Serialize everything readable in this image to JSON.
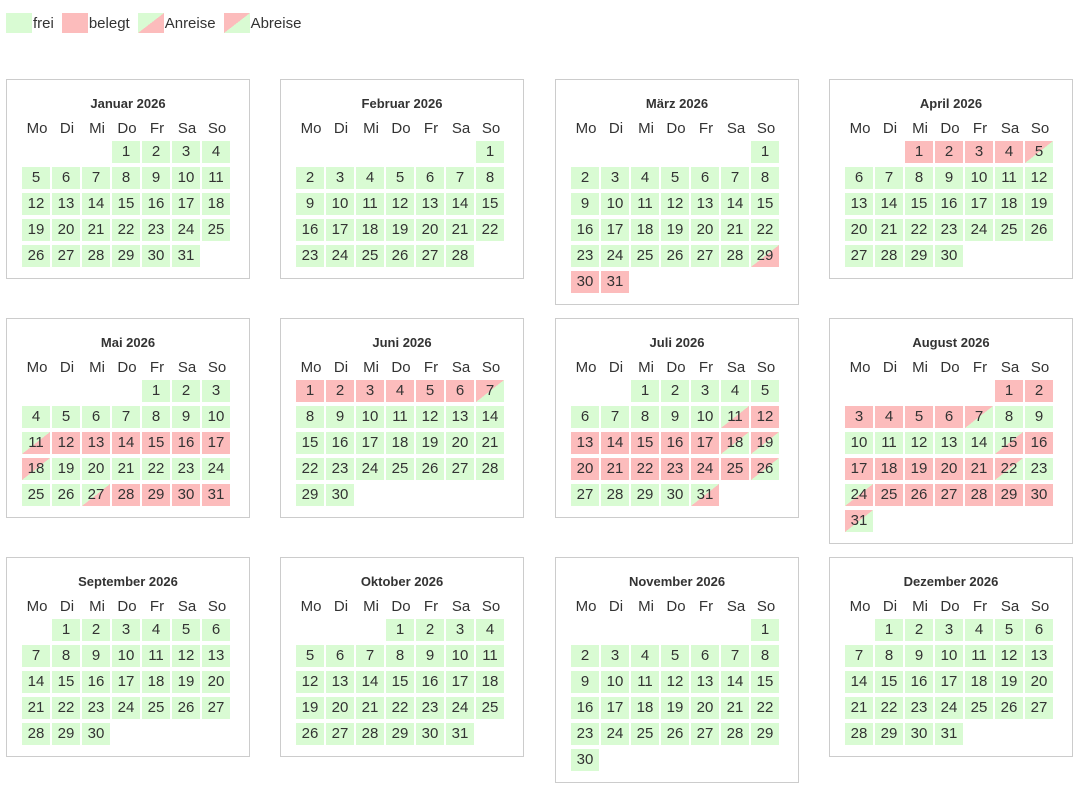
{
  "colors": {
    "frei": "#d9fbd3",
    "belegt": "#fcbcbc"
  },
  "legend": [
    {
      "key": "frei",
      "label": "frei"
    },
    {
      "key": "belegt",
      "label": "belegt"
    },
    {
      "key": "anreise",
      "label": "Anreise"
    },
    {
      "key": "abreise",
      "label": "Abreise"
    }
  ],
  "weekdays": [
    "Mo",
    "Di",
    "Mi",
    "Do",
    "Fr",
    "Sa",
    "So"
  ],
  "months": [
    {
      "title": "Januar 2026",
      "offset": 3,
      "days": 31,
      "status": {}
    },
    {
      "title": "Februar 2026",
      "offset": 6,
      "days": 28,
      "status": {}
    },
    {
      "title": "März 2026",
      "offset": 6,
      "days": 31,
      "status": {
        "29": "anreise",
        "30": "belegt",
        "31": "belegt"
      }
    },
    {
      "title": "April 2026",
      "offset": 2,
      "days": 30,
      "status": {
        "1": "belegt",
        "2": "belegt",
        "3": "belegt",
        "4": "belegt",
        "5": "abreise"
      }
    },
    {
      "title": "Mai 2026",
      "offset": 4,
      "days": 31,
      "status": {
        "11": "anreise",
        "12": "belegt",
        "13": "belegt",
        "14": "belegt",
        "15": "belegt",
        "16": "belegt",
        "17": "belegt",
        "18": "abreise",
        "27": "anreise",
        "28": "belegt",
        "29": "belegt",
        "30": "belegt",
        "31": "belegt"
      }
    },
    {
      "title": "Juni 2026",
      "offset": 0,
      "days": 30,
      "status": {
        "1": "belegt",
        "2": "belegt",
        "3": "belegt",
        "4": "belegt",
        "5": "belegt",
        "6": "belegt",
        "7": "abreise"
      }
    },
    {
      "title": "Juli 2026",
      "offset": 2,
      "days": 31,
      "status": {
        "11": "anreise",
        "12": "belegt",
        "13": "belegt",
        "14": "belegt",
        "15": "belegt",
        "16": "belegt",
        "17": "belegt",
        "18": "abreise",
        "19": "abreise",
        "20": "belegt",
        "21": "belegt",
        "22": "belegt",
        "23": "belegt",
        "24": "belegt",
        "25": "belegt",
        "26": "abreise",
        "31": "anreise"
      }
    },
    {
      "title": "August 2026",
      "offset": 5,
      "days": 31,
      "status": {
        "1": "belegt",
        "2": "belegt",
        "3": "belegt",
        "4": "belegt",
        "5": "belegt",
        "6": "belegt",
        "7": "abreise",
        "15": "anreise",
        "16": "belegt",
        "17": "belegt",
        "18": "belegt",
        "19": "belegt",
        "20": "belegt",
        "21": "belegt",
        "22": "abreise",
        "24": "anreise",
        "25": "belegt",
        "26": "belegt",
        "27": "belegt",
        "28": "belegt",
        "29": "belegt",
        "30": "belegt",
        "31": "abreise"
      }
    },
    {
      "title": "September 2026",
      "offset": 1,
      "days": 30,
      "status": {}
    },
    {
      "title": "Oktober 2026",
      "offset": 3,
      "days": 31,
      "status": {}
    },
    {
      "title": "November 2026",
      "offset": 6,
      "days": 30,
      "status": {}
    },
    {
      "title": "Dezember 2026",
      "offset": 1,
      "days": 31,
      "status": {}
    }
  ]
}
